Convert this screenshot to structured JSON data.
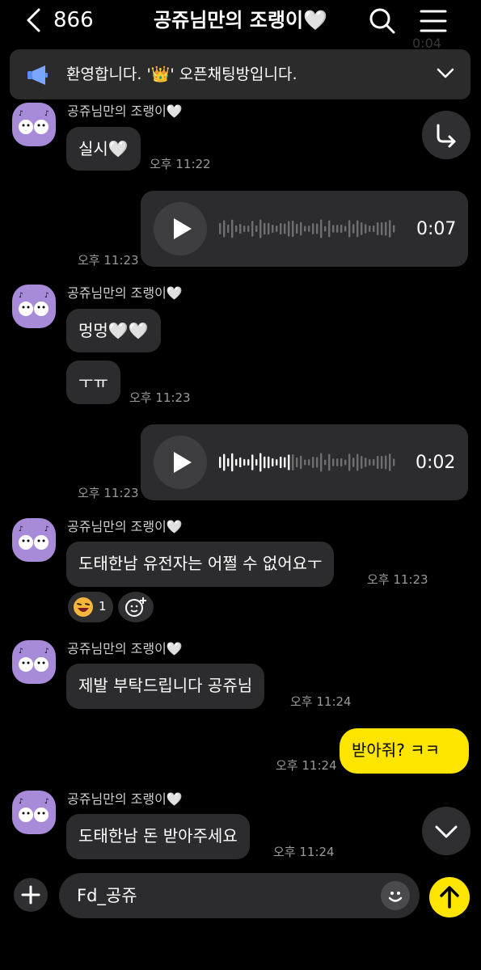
{
  "header": {
    "back_count": "866",
    "title": "공쥬님만의 조랭이🤍",
    "ghost_time": "0:04"
  },
  "notice": {
    "text_before": "환영합니다. '",
    "crown": "👑",
    "text_after": "' 오픈채팅방입니다."
  },
  "messages": [
    {
      "sender": "공쥬님만의 조랭이🤍",
      "text": "실시🤍",
      "time": "오후 11:22"
    },
    {
      "voice_duration": "0:07",
      "time": "오후 11:23"
    },
    {
      "sender": "공쥬님만의 조랭이🤍",
      "text1": "멍멍🤍🤍",
      "text2": "ㅜㅠ",
      "time": "오후 11:23"
    },
    {
      "voice_duration": "0:02",
      "time": "오후 11:23"
    },
    {
      "sender": "공쥬님만의 조랭이🤍",
      "text": "도태한남 유전자는 어쩔 수 없어요ㅜ",
      "time": "오후 11:23",
      "reaction_count": "1"
    },
    {
      "sender": "공쥬님만의 조랭이🤍",
      "text": "제발 부탁드립니다 공쥬님",
      "time": "오후 11:24"
    },
    {
      "text": "받아줘? ㅋㅋ",
      "time": "오후 11:24"
    },
    {
      "sender": "공쥬님만의 조랭이🤍",
      "text": "도태한남 돈 받아주세요",
      "time": "오후 11:24"
    }
  ],
  "input": {
    "value": "Fd_공쥬"
  },
  "colors": {
    "background": "#000000",
    "bubble_other": "#2c2c2e",
    "bubble_mine": "#fee500",
    "send_button": "#fee500",
    "avatar_bg": "#a78bd8"
  },
  "icons": [
    "back-chevron-icon",
    "search-icon",
    "menu-icon",
    "megaphone-icon",
    "chevron-down-icon",
    "share-arrow-icon",
    "play-icon",
    "add-reaction-icon",
    "plus-icon",
    "emoji-icon",
    "send-arrow-icon"
  ]
}
